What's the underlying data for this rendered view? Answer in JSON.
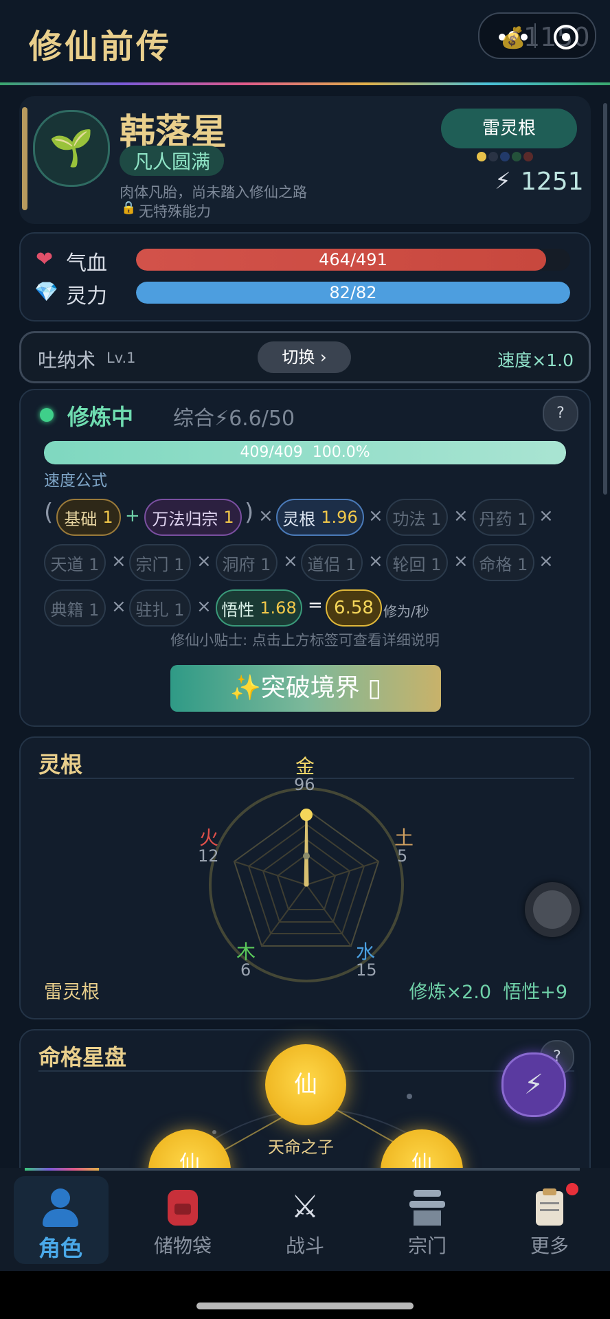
{
  "header": {
    "title": "修仙前传",
    "money": "1150"
  },
  "character": {
    "name": "韩落星",
    "realm": "凡人圆满",
    "desc": "肉体凡胎，尚未踏入修仙之路",
    "ability": "无特殊能力",
    "root_badge": "雷灵根",
    "power": "1251"
  },
  "stats": {
    "hp_label": "气血",
    "hp_value": "464/491",
    "hp_fraction": 0.945,
    "mp_label": "灵力",
    "mp_value": "82/82",
    "mp_fraction": 1.0
  },
  "technique": {
    "name": "吐纳术",
    "level": "Lv.1",
    "switch": "切换 ›",
    "speed": "速度×1.0"
  },
  "cultivation": {
    "status": "修炼中",
    "composite": "综合⚡6.6/50",
    "progress_text": "409/409  100.0%",
    "progress_fraction": 1.0,
    "formula_label": "速度公式",
    "chips": {
      "base": "基础",
      "base_v": "1",
      "wanfa": "万法归宗",
      "wanfa_v": "1",
      "root": "灵根",
      "root_v": "1.96",
      "gongfa": "功法 1",
      "danyao": "丹药 1",
      "tiandao": "天道 1",
      "zongmen": "宗门 1",
      "dongfu": "洞府 1",
      "daolv": "道侣 1",
      "lunhui": "轮回 1",
      "mingge": "命格 1",
      "dianji": "典籍 1",
      "zhuzha": "驻扎 1",
      "wuxing": "悟性",
      "wuxing_v": "1.68",
      "result": "6.58",
      "unit": "修为/秒"
    },
    "tip": "修仙小贴士: 点击上方标签可查看详细说明",
    "breakthrough": "✨突破境界 ▯"
  },
  "spirit_root": {
    "title": "灵根",
    "elements": {
      "metal": {
        "label": "金",
        "value": "96"
      },
      "earth": {
        "label": "土",
        "value": "5"
      },
      "water": {
        "label": "水",
        "value": "15"
      },
      "wood": {
        "label": "木",
        "value": "6"
      },
      "fire": {
        "label": "火",
        "value": "12"
      }
    },
    "footer_left": "雷灵根",
    "footer_right": "修炼×2.0  悟性+9"
  },
  "fate": {
    "title": "命格星盘",
    "node_char": "仙",
    "node_name": "天命之子",
    "help": "?"
  },
  "nav": {
    "items": [
      {
        "label": "角色"
      },
      {
        "label": "储物袋"
      },
      {
        "label": "战斗"
      },
      {
        "label": "宗门"
      },
      {
        "label": "更多"
      }
    ]
  },
  "colors": {
    "accent_teal": "#3aa88e",
    "gold": "#e9cf8c",
    "hp": "#d8554a",
    "mp": "#4a9fe0"
  }
}
